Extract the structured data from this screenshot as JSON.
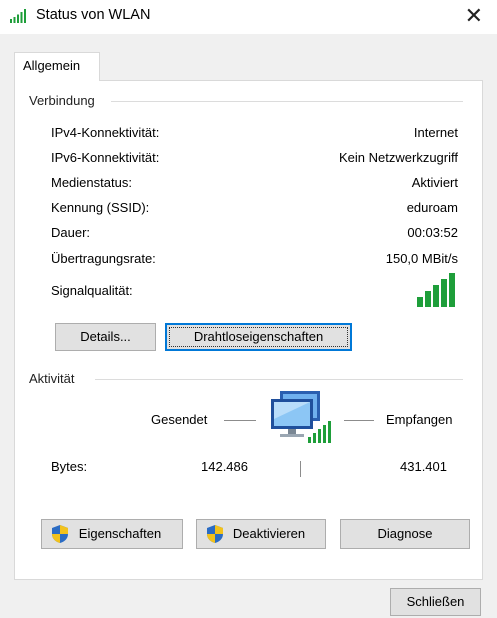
{
  "window": {
    "title": "Status von WLAN",
    "close_glyph": "✕",
    "title_icon": "wifi-signal-icon"
  },
  "tabs": [
    {
      "label": "Allgemein",
      "selected": true
    }
  ],
  "connection": {
    "group_label": "Verbindung",
    "rows": [
      {
        "label": "IPv4-Konnektivität:",
        "value": "Internet"
      },
      {
        "label": "IPv6-Konnektivität:",
        "value": "Kein Netzwerkzugriff"
      },
      {
        "label": "Medienstatus:",
        "value": "Aktiviert"
      },
      {
        "label": "Kennung (SSID):",
        "value": "eduroam"
      },
      {
        "label": "Dauer:",
        "value": "00:03:52"
      },
      {
        "label": "Übertragungsrate:",
        "value": "150,0 MBit/s"
      }
    ],
    "signal_label": "Signalqualität:",
    "signal_bars": 5,
    "signal_bars_max": 5,
    "details_button": "Details...",
    "wireless_props_button": "Drahtloseigenschaften"
  },
  "activity": {
    "group_label": "Aktivität",
    "sent_label": "Gesendet",
    "received_label": "Empfangen",
    "bytes_label": "Bytes:",
    "bytes_sent": "142.486",
    "bytes_received": "431.401",
    "icon": "network-computer-icon"
  },
  "bottom_buttons": {
    "properties": "Eigenschaften",
    "disable": "Deaktivieren",
    "diagnose": "Diagnose"
  },
  "close_button": "Schließen",
  "colors": {
    "signal_green": "#1e9e3a",
    "focus_blue": "#0078d7",
    "shield_blue": "#2b6cc4",
    "shield_yellow": "#f2c21c"
  }
}
